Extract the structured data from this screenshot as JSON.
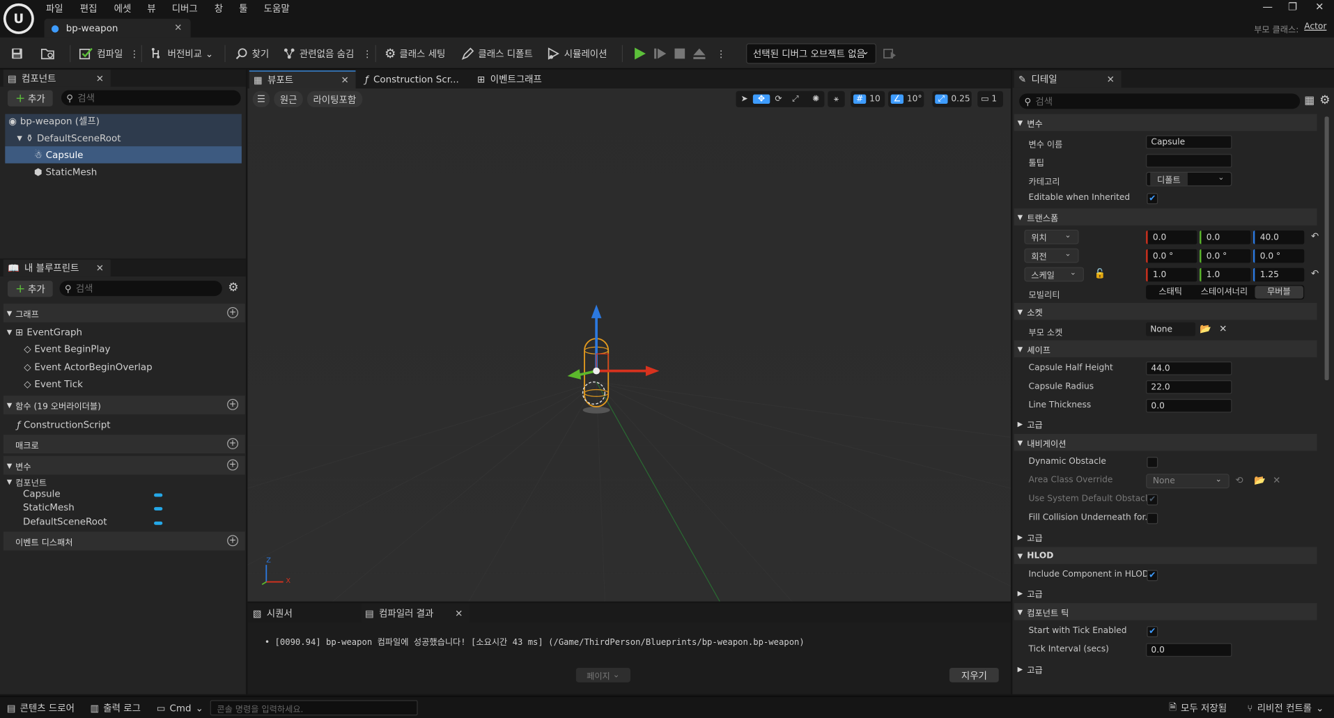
{
  "menu": [
    "파일",
    "편집",
    "에셋",
    "뷰",
    "디버그",
    "창",
    "툴",
    "도움말"
  ],
  "document_tab": "bp-weapon",
  "parent_class": {
    "label": "부모 클래스:",
    "value": "Actor"
  },
  "toolbar": {
    "compile": "컴파일",
    "diff": "버전비교",
    "find": "찾기",
    "hide_unrelated": "관련없음 숨김",
    "class_settings": "클래스 세팅",
    "class_defaults": "클래스 디폴트",
    "simulation": "시뮬레이션",
    "debug_object": "선택된 디버그 오브젝트 없음"
  },
  "components_panel": {
    "tab": "컴포넌트",
    "add": "추가",
    "search_placeholder": "검색",
    "tree": [
      "bp-weapon (셀프)",
      "DefaultSceneRoot",
      "Capsule",
      "StaticMesh"
    ]
  },
  "my_blueprint": {
    "tab": "내 블루프린트",
    "add": "추가",
    "search_placeholder": "검색",
    "graph_section": "그래프",
    "event_graph": "EventGraph",
    "events": [
      "Event BeginPlay",
      "Event ActorBeginOverlap",
      "Event Tick"
    ],
    "functions_section": "함수 (19 오버라이더블)",
    "construction": "ConstructionScript",
    "macros": "매크로",
    "variables": "변수",
    "components_group": "컴포넌트",
    "component_vars": [
      "Capsule",
      "StaticMesh",
      "DefaultSceneRoot"
    ],
    "dispatchers": "이벤트 디스패처"
  },
  "center_tabs": [
    "뷰포트",
    "Construction Scr...",
    "이벤트그래프"
  ],
  "viewport": {
    "perspective": "원근",
    "lit": "라이팅포함",
    "grid_snap": "10",
    "rot_snap": "10°",
    "scale_snap": "0.25",
    "camera_speed": "1",
    "axis_x": "X",
    "axis_z": "Z"
  },
  "bottom_tabs": [
    "시퀀서",
    "컴파일러 결과"
  ],
  "compiler_log": "[0090.94] bp-weapon 컴파일에 성공했습니다! [소요시간 43 ms] (/Game/ThirdPerson/Blueprints/bp-weapon.bp-weapon)",
  "page_button": "페이지",
  "clear_button": "지우기",
  "details": {
    "tab": "디테일",
    "search_placeholder": "검색",
    "var_section": "변수",
    "var_name_label": "변수 이름",
    "var_name": "Capsule",
    "tooltip_label": "툴팁",
    "category_label": "카테고리",
    "category": "디폴트",
    "editable_label": "Editable when Inherited",
    "transform_section": "트랜스폼",
    "location_label": "위치",
    "location": [
      "0.0",
      "0.0",
      "40.0"
    ],
    "rotation_label": "회전",
    "rotation": [
      "0.0 °",
      "0.0 °",
      "0.0 °"
    ],
    "scale_label": "스케일",
    "scale": [
      "1.0",
      "1.0",
      "1.25"
    ],
    "mobility_label": "모빌리티",
    "mobility": [
      "스태틱",
      "스테이셔너리",
      "무버블"
    ],
    "sockets_section": "소켓",
    "parent_socket_label": "부모 소켓",
    "parent_socket": "None",
    "shape_section": "셰이프",
    "half_height_label": "Capsule Half Height",
    "half_height": "44.0",
    "radius_label": "Capsule Radius",
    "radius": "22.0",
    "line_thickness_label": "Line Thickness",
    "line_thickness": "0.0",
    "advanced": "고급",
    "nav_section": "내비게이션",
    "dynamic_obstacle": "Dynamic Obstacle",
    "area_class_label": "Area Class Override",
    "area_class": "None",
    "use_default_label": "Use System Default Obstacl...",
    "fill_collision_label": "Fill Collision Underneath for...",
    "hlod_section": "HLOD",
    "include_hlod": "Include Component in HLOD",
    "tick_section": "컴포넌트 틱",
    "start_tick": "Start with Tick Enabled",
    "tick_interval_label": "Tick Interval (secs)",
    "tick_interval": "0.0"
  },
  "statusbar": {
    "content_drawer": "콘텐츠 드로어",
    "output_log": "출력 로그",
    "cmd": "Cmd",
    "cmd_placeholder": "콘솔 명령을 입력하세요.",
    "save_all": "모두 저장됨",
    "revision": "리비전 컨트롤"
  },
  "colors": {
    "accent": "#3e9cff",
    "selection": "#3d5a80",
    "play": "#5cbf3a",
    "axis_x": "#d7321e",
    "axis_y": "#5cb82c",
    "axis_z": "#2c79e0"
  }
}
